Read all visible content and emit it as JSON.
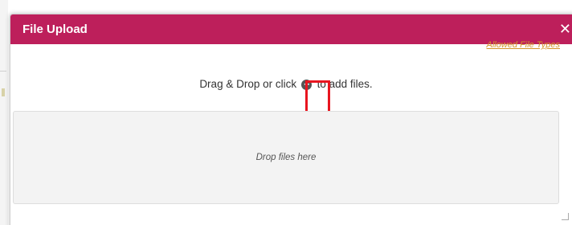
{
  "dialog": {
    "title": "File Upload",
    "close_label": "✕",
    "allowed_types_link": "Allowed File Types",
    "instructions": {
      "before": "Drag & Drop or click",
      "icon": "plus-circle-icon",
      "after": "to add files."
    },
    "dropzone_text": "Drop files here"
  },
  "colors": {
    "header": "#bd1f5b",
    "link": "#d4952a",
    "highlight": "#e8151f"
  }
}
